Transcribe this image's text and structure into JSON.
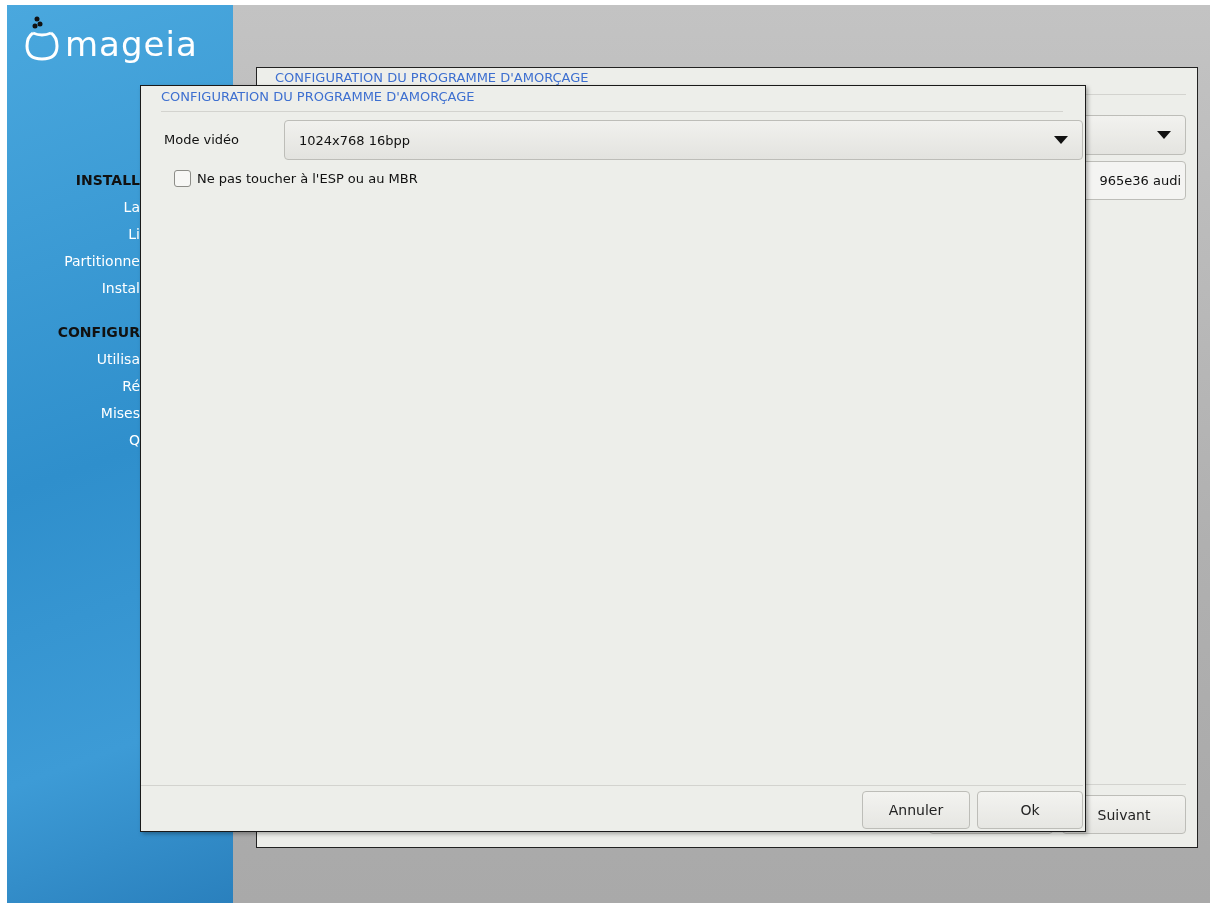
{
  "sidebar": {
    "logo_text": "mageia",
    "sections": [
      {
        "heading": "INSTALL",
        "items": [
          "La",
          "Li",
          "Partitionne",
          "Instal"
        ]
      },
      {
        "heading": "CONFIGUR",
        "items": [
          "Utilisa",
          "Ré",
          "Mises",
          "Q"
        ]
      }
    ]
  },
  "back_window": {
    "title": "CONFIGURATION DU PROGRAMME D'AMORÇAGE",
    "field_value": "965e36 audi",
    "buttons": [
      "Suivant"
    ]
  },
  "dialog": {
    "title": "CONFIGURATION DU PROGRAMME D'AMORÇAGE",
    "fields": [
      {
        "kind": "select",
        "label": "Mode vidéo",
        "value": "1024x768 16bpp"
      },
      {
        "kind": "checkbox",
        "label": "Ne pas toucher à l'ESP ou au MBR",
        "checked": false
      }
    ],
    "buttons": [
      "Annuler",
      "Ok"
    ]
  }
}
